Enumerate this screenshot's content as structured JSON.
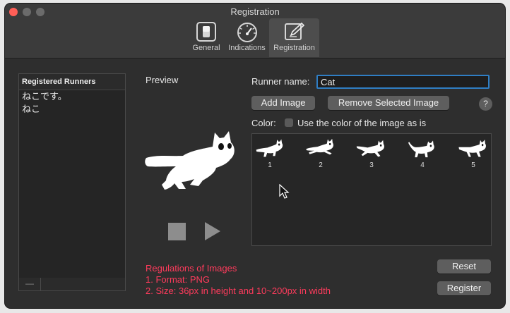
{
  "window": {
    "title": "Registration"
  },
  "toolbar": {
    "items": [
      {
        "label": "General",
        "icon": "general-icon"
      },
      {
        "label": "Indications",
        "icon": "gauge-icon"
      },
      {
        "label": "Registration",
        "icon": "pen-icon",
        "selected": true
      }
    ]
  },
  "runners": {
    "header": "Registered Runners",
    "rows": [
      "ねこです。",
      "ねこ"
    ],
    "remove_button": "—"
  },
  "preview": {
    "label": "Preview"
  },
  "form": {
    "runner_name_label": "Runner name:",
    "runner_name_value": "Cat",
    "add_image": "Add Image",
    "remove_image": "Remove Selected Image",
    "help": "?",
    "color_label": "Color:",
    "color_checkbox_label": "Use the color of the image as is",
    "color_checked": false
  },
  "images": {
    "frames": [
      "1",
      "2",
      "3",
      "4",
      "5"
    ]
  },
  "regulations": {
    "title": "Regulations of Images",
    "rule1": "1. Format: PNG",
    "rule2": "2. Size: 36px in height and 10~200px in width"
  },
  "actions": {
    "reset": "Reset",
    "register": "Register"
  },
  "colors": {
    "accent": "#2f7ec4",
    "warning_text": "#ff3b5c",
    "window_bg": "#2e2e2e"
  }
}
